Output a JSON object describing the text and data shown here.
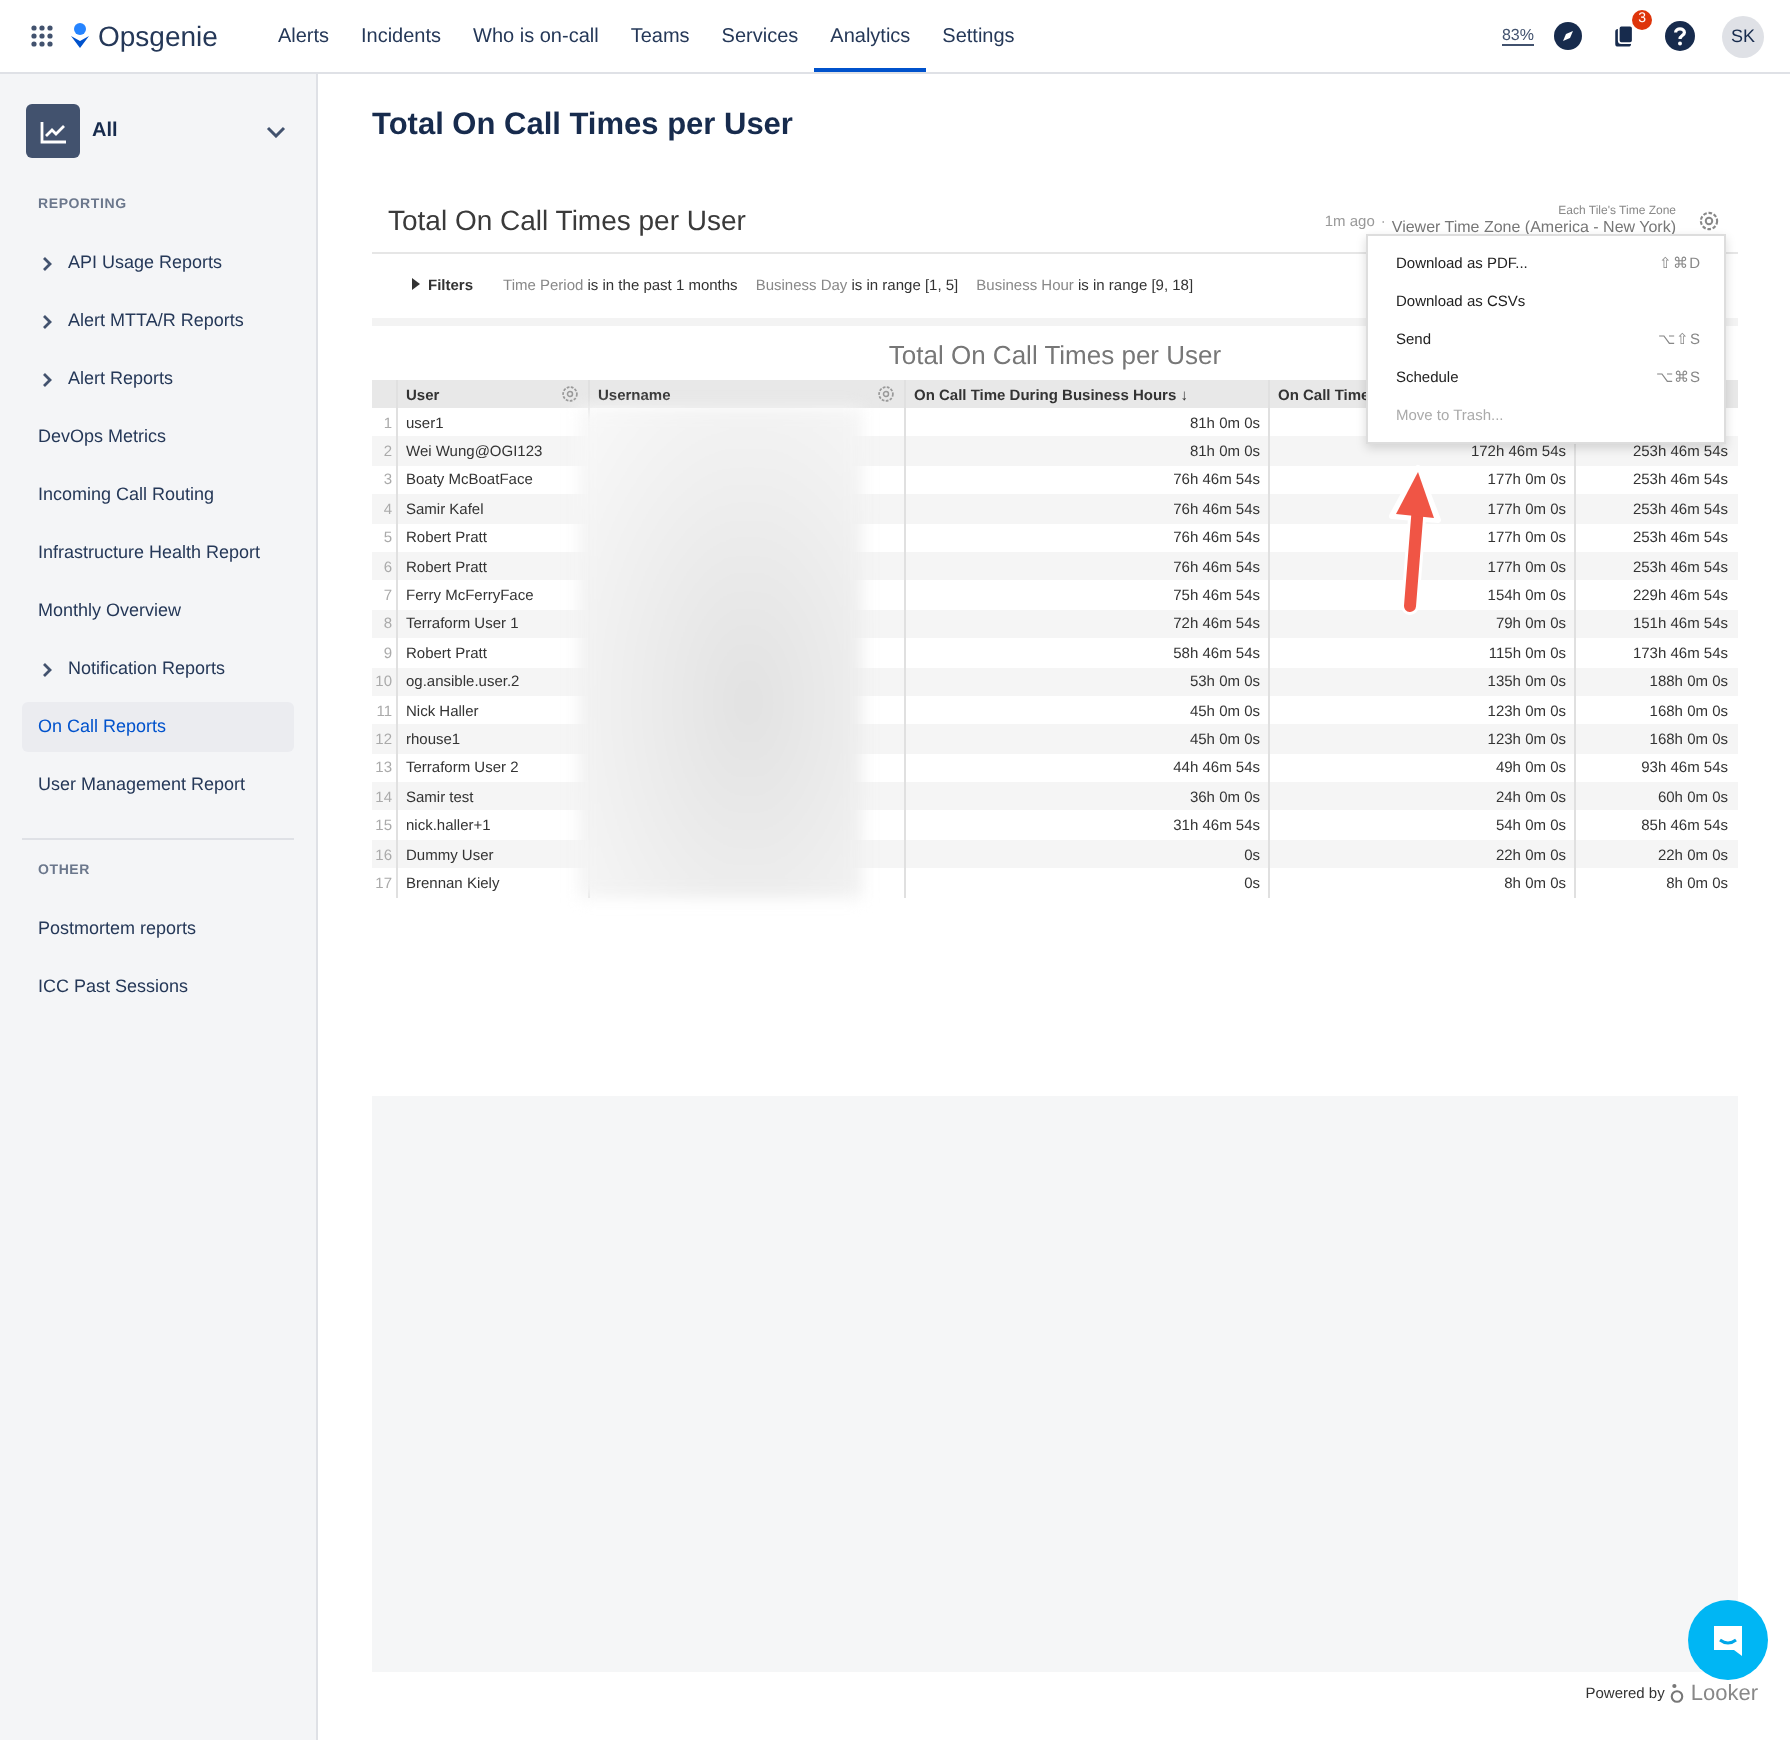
{
  "nav": {
    "product": "Opsgenie",
    "items": [
      {
        "label": "Alerts",
        "selected": false
      },
      {
        "label": "Incidents",
        "selected": false
      },
      {
        "label": "Who is on-call",
        "selected": false
      },
      {
        "label": "Teams",
        "selected": false
      },
      {
        "label": "Services",
        "selected": false
      },
      {
        "label": "Analytics",
        "selected": true
      },
      {
        "label": "Settings",
        "selected": false
      }
    ],
    "zoom": "83%",
    "badge": "3",
    "avatar": "SK"
  },
  "sidebar": {
    "scope": "All",
    "sections": [
      {
        "heading": "REPORTING",
        "items": [
          {
            "label": "API Usage Reports",
            "expandable": true,
            "selected": false
          },
          {
            "label": "Alert MTTA/R Reports",
            "expandable": true,
            "selected": false
          },
          {
            "label": "Alert Reports",
            "expandable": true,
            "selected": false
          },
          {
            "label": "DevOps Metrics",
            "expandable": false,
            "selected": false
          },
          {
            "label": "Incoming Call Routing",
            "expandable": false,
            "selected": false
          },
          {
            "label": "Infrastructure Health Report",
            "expandable": false,
            "selected": false
          },
          {
            "label": "Monthly Overview",
            "expandable": false,
            "selected": false
          },
          {
            "label": "Notification Reports",
            "expandable": true,
            "selected": false
          },
          {
            "label": "On Call Reports",
            "expandable": false,
            "selected": true
          },
          {
            "label": "User Management Report",
            "expandable": false,
            "selected": false
          }
        ]
      },
      {
        "heading": "OTHER",
        "items": [
          {
            "label": "Postmortem reports",
            "expandable": false,
            "selected": false
          },
          {
            "label": "ICC Past Sessions",
            "expandable": false,
            "selected": false
          }
        ]
      }
    ]
  },
  "page_title": "Total On Call Times per User",
  "tile": {
    "title": "Total On Call Times per User",
    "updated": "1m ago",
    "separator": "·",
    "timezone_caption": "Each Tile's Time Zone",
    "timezone": "Viewer Time Zone (America - New York)",
    "filters_label": "Filters",
    "filters": [
      {
        "field": "Time Period",
        "condition": "is in the past 1 months"
      },
      {
        "field": "Business Day",
        "condition": "is in range [1, 5]"
      },
      {
        "field": "Business Hour",
        "condition": "is in range [9, 18]"
      }
    ],
    "chart_title": "Total On Call Times per User",
    "columns": [
      {
        "label": "User",
        "gear": true
      },
      {
        "label": "Username",
        "gear": true
      },
      {
        "label": "On Call Time During Business Hours ↓",
        "gear": false
      },
      {
        "label": "On Call Time",
        "gear": false
      }
    ],
    "rows": [
      {
        "n": "1",
        "user": "user1",
        "business": "81h 0m 0s"
      },
      {
        "n": "2",
        "user": "Wei Wung@OGI123",
        "business": "81h 0m 0s",
        "column_4": "172h 46m 54s",
        "column_5": "253h 46m 54s"
      },
      {
        "n": "3",
        "user": "Boaty McBoatFace",
        "business": "76h 46m 54s",
        "column_4": "177h 0m 0s",
        "column_5": "253h 46m 54s"
      },
      {
        "n": "4",
        "user": "Samir Kafel",
        "business": "76h 46m 54s",
        "column_4": "177h 0m 0s",
        "column_5": "253h 46m 54s"
      },
      {
        "n": "5",
        "user": "Robert Pratt",
        "business": "76h 46m 54s",
        "column_4": "177h 0m 0s",
        "column_5": "253h 46m 54s"
      },
      {
        "n": "6",
        "user": "Robert Pratt",
        "business": "76h 46m 54s",
        "column_4": "177h 0m 0s",
        "column_5": "253h 46m 54s"
      },
      {
        "n": "7",
        "user": "Ferry McFerryFace",
        "business": "75h 46m 54s",
        "column_4": "154h 0m 0s",
        "column_5": "229h 46m 54s"
      },
      {
        "n": "8",
        "user": "Terraform User 1",
        "business": "72h 46m 54s",
        "column_4": "79h 0m 0s",
        "column_5": "151h 46m 54s"
      },
      {
        "n": "9",
        "user": "Robert Pratt",
        "business": "58h 46m 54s",
        "column_4": "115h 0m 0s",
        "column_5": "173h 46m 54s"
      },
      {
        "n": "10",
        "user": "og.ansible.user.2",
        "business": "53h 0m 0s",
        "column_4": "135h 0m 0s",
        "column_5": "188h 0m 0s"
      },
      {
        "n": "11",
        "user": "Nick Haller",
        "business": "45h 0m 0s",
        "column_4": "123h 0m 0s",
        "column_5": "168h 0m 0s"
      },
      {
        "n": "12",
        "user": "rhouse1",
        "business": "45h 0m 0s",
        "column_4": "123h 0m 0s",
        "column_5": "168h 0m 0s"
      },
      {
        "n": "13",
        "user": "Terraform User 2",
        "business": "44h 46m 54s",
        "column_4": "49h 0m 0s",
        "column_5": "93h 46m 54s"
      },
      {
        "n": "14",
        "user": "Samir test",
        "business": "36h 0m 0s",
        "column_4": "24h 0m 0s",
        "column_5": "60h 0m 0s"
      },
      {
        "n": "15",
        "user": "nick.haller+1",
        "business": "31h 46m 54s",
        "column_4": "54h 0m 0s",
        "column_5": "85h 46m 54s"
      },
      {
        "n": "16",
        "user": "Dummy User",
        "business": "0s",
        "column_4": "22h 0m 0s",
        "column_5": "22h 0m 0s"
      },
      {
        "n": "17",
        "user": "Brennan Kiely",
        "business": "0s",
        "column_4": "8h 0m 0s",
        "column_5": "8h 0m 0s"
      }
    ],
    "menu": [
      {
        "label": "Download as PDF...",
        "shortcut": "⇧⌘D",
        "disabled": false
      },
      {
        "label": "Download as CSVs",
        "disabled": false
      },
      {
        "label": "Send",
        "shortcut": "⌥⇧S",
        "disabled": false
      },
      {
        "label": "Schedule",
        "shortcut": "⌥⌘S",
        "disabled": false
      },
      {
        "label": "Move to Trash...",
        "disabled": true
      }
    ]
  },
  "footer": {
    "powered_by": "Powered by",
    "brand": "Looker"
  }
}
